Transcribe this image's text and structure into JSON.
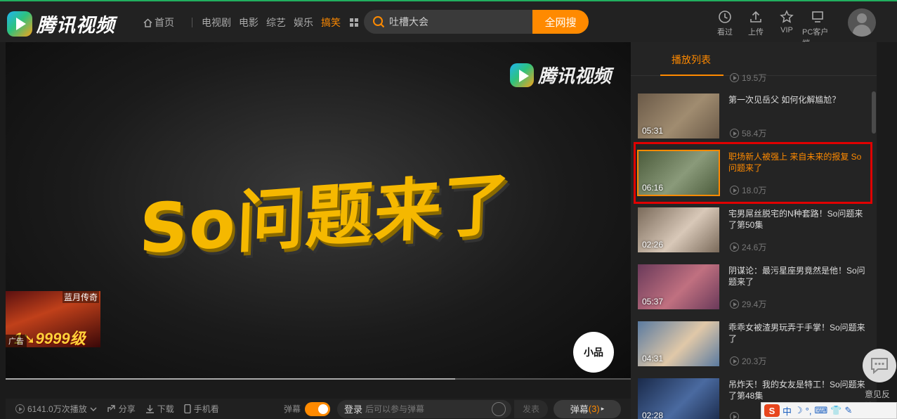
{
  "app": {
    "logo_text": "腾讯视频"
  },
  "nav": {
    "home": "首页",
    "items": [
      "电视剧",
      "电影",
      "综艺",
      "娱乐"
    ],
    "active": "搞笑"
  },
  "search": {
    "value": "吐槽大会",
    "button": "全网搜"
  },
  "tools": [
    {
      "icon": "history-icon",
      "label": "看过"
    },
    {
      "icon": "upload-icon",
      "label": "上传"
    },
    {
      "icon": "vip-icon",
      "label": "VIP"
    },
    {
      "icon": "pc-client-icon",
      "label": "PC客户端"
    }
  ],
  "player": {
    "watermark": "腾讯视频",
    "title_art": "So问题来了",
    "ad": {
      "title": "蓝月传奇",
      "level": "1➘9999级",
      "tag": "广告"
    },
    "channel_logo": "小品"
  },
  "bottom_bar": {
    "plays": "6141.0万次播放",
    "share": "分享",
    "download": "下载",
    "mobile": "手机看",
    "danmaku_label": "弹幕",
    "login": "登录",
    "placeholder": "后可以参与弹幕",
    "send": "发表",
    "danmaku_button": "弹幕",
    "danmaku_count": "(3)"
  },
  "playlist": {
    "tab": "播放列表",
    "prev_views": "19.5万",
    "items": [
      {
        "title": "第一次见岳父 如何化解尴尬？",
        "duration": "05:31",
        "views": "58.4万",
        "colors": [
          "#6b5a48",
          "#a08c70"
        ]
      },
      {
        "title": "职场新人被强上 来自未来的报复 So问题来了",
        "duration": "06:16",
        "views": "18.0万",
        "colors": [
          "#4a5a3a",
          "#8a9a7a"
        ],
        "active": true
      },
      {
        "title": "宅男屌丝脱宅的N种套路！So问题来了第50集",
        "duration": "02:26",
        "views": "24.6万",
        "colors": [
          "#7a6a5a",
          "#d8c8b8"
        ]
      },
      {
        "title": "阴谋论：最污星座男竟然是他！So问题来了",
        "duration": "05:37",
        "views": "29.4万",
        "colors": [
          "#6a3a5a",
          "#c07080"
        ]
      },
      {
        "title": "乖乖女被渣男玩弄于手掌！So问题来了",
        "duration": "04:31",
        "views": "20.3万",
        "colors": [
          "#5a7aa0",
          "#e0c8a8"
        ]
      },
      {
        "title": "吊炸天！我的女友是特工！So问题来了第48集",
        "duration": "02:28",
        "views": "",
        "colors": [
          "#1a2a4a",
          "#4a6aa0"
        ]
      }
    ]
  },
  "feedback": {
    "label": "意见反馈"
  },
  "ime": {
    "mode": "中"
  }
}
